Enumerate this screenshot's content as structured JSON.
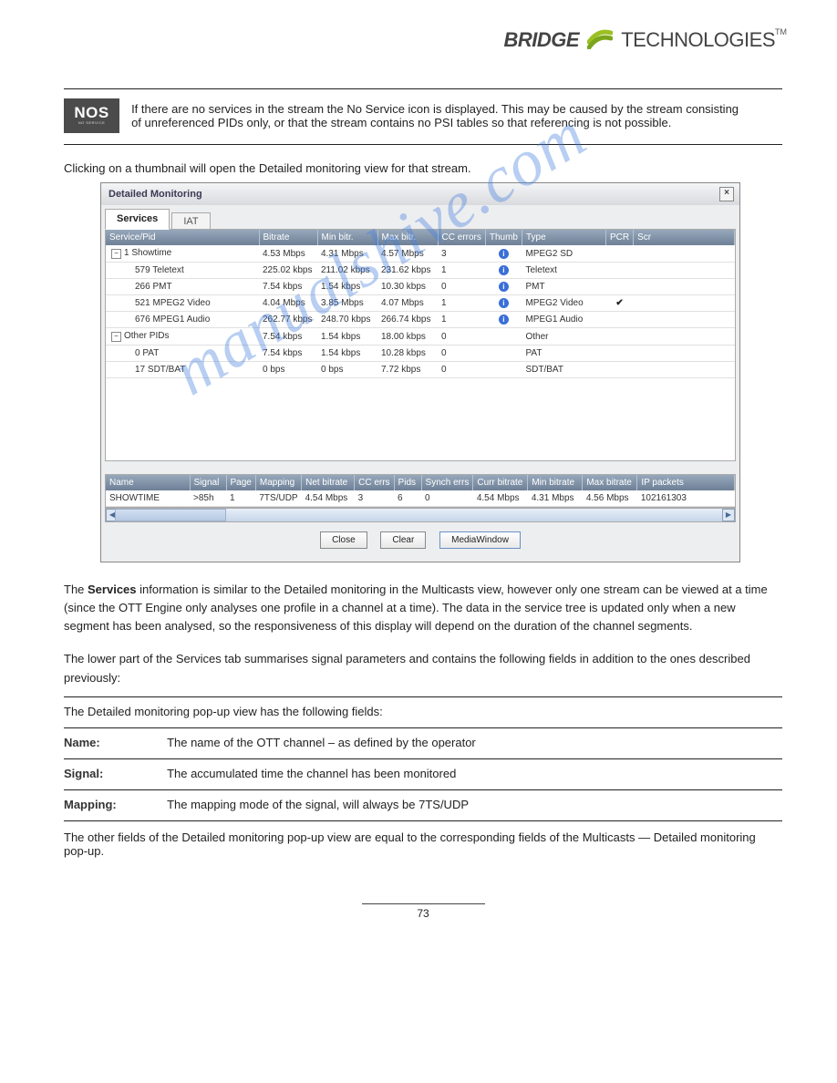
{
  "logo": {
    "left": "BRIDGE",
    "right": "TECHNOLOGIES",
    "tm": "TM"
  },
  "nos": {
    "label": "NOS",
    "sub": "NO SERVICE"
  },
  "intro": "If there are no services in the stream the No Service icon is displayed. This may be caused by the stream consisting of unreferenced PIDs only, or that the stream contains no PSI tables so that referencing is not possible.",
  "postIntro": "Clicking on a thumbnail will open the Detailed monitoring view for that stream.",
  "watermark": "manualshive.com",
  "window": {
    "title": "Detailed Monitoring",
    "close": "×",
    "tabs": {
      "t1": "Services",
      "t2": "IAT"
    },
    "cols": [
      "Service/Pid",
      "Bitrate",
      "Min bitr.",
      "Max bitr.",
      "CC errors",
      "Thumb",
      "Type",
      "PCR",
      "Scr"
    ],
    "rows": [
      {
        "name": "1 Showtime",
        "toggle": "−",
        "bitrate": "4.53 Mbps",
        "min": "4.31 Mbps",
        "max": "4.57 Mbps",
        "cc": "3",
        "thumb": true,
        "type": "MPEG2 SD",
        "pcr": "",
        "depth": 0
      },
      {
        "name": "579 Teletext",
        "bitrate": "225.02 kbps",
        "min": "211.02 kbps",
        "max": "231.62 kbps",
        "cc": "1",
        "thumb": true,
        "type": "Teletext",
        "pcr": "",
        "depth": 1
      },
      {
        "name": "266 PMT",
        "bitrate": "7.54 kbps",
        "min": "1.54 kbps",
        "max": "10.30 kbps",
        "cc": "0",
        "thumb": true,
        "type": "PMT",
        "pcr": "",
        "depth": 1
      },
      {
        "name": "521 MPEG2 Video",
        "bitrate": "4.04 Mbps",
        "min": "3.85 Mbps",
        "max": "4.07 Mbps",
        "cc": "1",
        "thumb": true,
        "type": "MPEG2 Video",
        "pcr": "✔",
        "depth": 1
      },
      {
        "name": "676 MPEG1 Audio",
        "bitrate": "262.77 kbps",
        "min": "248.70 kbps",
        "max": "266.74 kbps",
        "cc": "1",
        "thumb": true,
        "type": "MPEG1 Audio",
        "pcr": "",
        "depth": 1
      },
      {
        "name": "Other PIDs",
        "toggle": "−",
        "bitrate": "7.54 kbps",
        "min": "1.54 kbps",
        "max": "18.00 kbps",
        "cc": "0",
        "thumb": false,
        "type": "Other",
        "pcr": "",
        "depth": 0
      },
      {
        "name": "0 PAT",
        "bitrate": "7.54 kbps",
        "min": "1.54 kbps",
        "max": "10.28 kbps",
        "cc": "0",
        "thumb": false,
        "type": "PAT",
        "pcr": "",
        "depth": 1
      },
      {
        "name": "17 SDT/BAT",
        "bitrate": "0 bps",
        "min": "0 bps",
        "max": "7.72 kbps",
        "cc": "0",
        "thumb": false,
        "type": "SDT/BAT",
        "pcr": "",
        "depth": 1
      }
    ],
    "sumCols": [
      "Name",
      "Signal",
      "Page",
      "Mapping",
      "Net bitrate",
      "CC errs",
      "Pids",
      "Synch errs",
      "Curr bitrate",
      "Min bitrate",
      "Max bitrate",
      "IP packets"
    ],
    "sumRow": {
      "name": "SHOWTIME",
      "signal": ">85h",
      "page": "1",
      "mapping": "7TS/UDP",
      "net": "4.54 Mbps",
      "cc": "3",
      "pids": "6",
      "synch": "0",
      "curr": "4.54 Mbps",
      "min": "4.31 Mbps",
      "max": "4.56 Mbps",
      "ip": "102161303"
    },
    "buttons": {
      "close": "Close",
      "clear": "Clear",
      "media": "MediaWindow"
    }
  },
  "para": {
    "p1a": "The ",
    "p1b": "Services",
    "p1c": " information is similar to the Detailed monitoring in the Multicasts view, however only one stream can be viewed at a time (since the OTT Engine only analyses one profile in a channel at a time). The data in the service tree is updated only when a new segment has been analysed, so the responsiveness of this display will depend on the duration of the channel segments.",
    "p2": "The lower part of the Services tab summarises signal parameters and contains the following fields in addition to the ones described previously:"
  },
  "defs": {
    "intro": "The Detailed monitoring pop-up view has the following fields:",
    "r1": {
      "term": "Name:",
      "desc": "The name of the OTT channel – as defined by the operator"
    },
    "r2": {
      "term": "Signal:",
      "desc": "The accumulated time the channel has been monitored"
    },
    "r3": {
      "term": "Mapping:",
      "desc": "The mapping mode of the signal, will always be 7TS/UDP"
    },
    "p3": "The other fields of the Detailed monitoring pop-up view are equal to the corresponding fields of the Multicasts — Detailed monitoring pop-up."
  },
  "footer": "73"
}
